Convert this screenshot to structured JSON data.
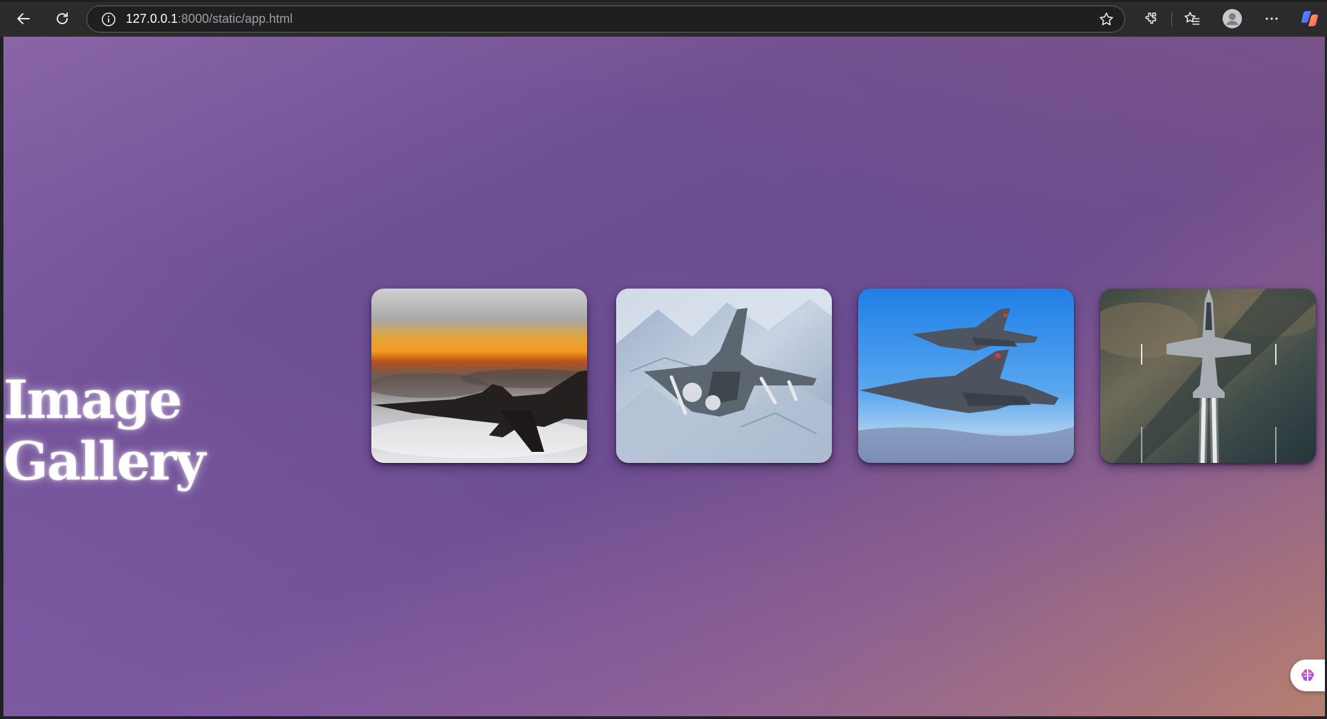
{
  "browser": {
    "url_host": "127.0.0.1",
    "url_path": ":8000/static/app.html",
    "icons": [
      "back-arrow-icon",
      "reload-icon",
      "site-info-icon",
      "bookmark-star-icon",
      "extensions-icon",
      "favorites-icon",
      "profile-avatar-icon",
      "more-menu-icon",
      "copilot-icon"
    ]
  },
  "page": {
    "title": "Image Gallery",
    "images": [
      {
        "subject": "jet silhouette at sunset above clouds"
      },
      {
        "subject": "fighter jet over snowy mountains"
      },
      {
        "subject": "two fighter jets in blue sky"
      },
      {
        "subject": "fighter jet top view with contrails"
      }
    ],
    "colors": {
      "bg_purple": "#6b4c91",
      "bg_orange": "#b8806e",
      "title": "#ffffff"
    }
  }
}
